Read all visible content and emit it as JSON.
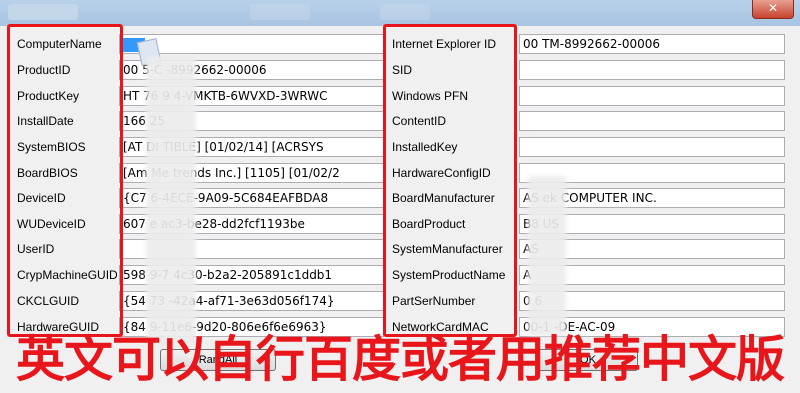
{
  "window": {
    "close_glyph": "✕"
  },
  "left_labels": [
    "ComputerName",
    "ProductID",
    "ProductKey",
    "InstallDate",
    "SystemBIOS",
    "BoardBIOS",
    "DeviceID",
    "WUDeviceID",
    "UserID",
    "CrypMachineGUID",
    "CKCLGUID",
    "HardwareGUID"
  ],
  "left_values": [
    "",
    "00         5-C    -8992662-00006",
    "HT       76    9     4-VMKTB-6WVXD-3WRWC",
    "166        25",
    "[AT       DI         TIBLE] [01/02/14] [ACRSYS",
    "[Am        Me     trends Inc.] [1105] [01/02/2",
    "{C7               6-4ECE-9A09-5C684EAFBDA8",
    "607        e        ac3-be28-dd2fcf1193be",
    "",
    "598        9-7        4c30-b2a2-205891c1ddb1",
    "{54          73        -42a4-af71-3e63d056f174}",
    "{84             9-11e6-9d20-806e6f6e6963}"
  ],
  "right_labels": [
    "Internet Explorer ID",
    "SID",
    "Windows PFN",
    "ContentID",
    "InstalledKey",
    "HardwareConfigID",
    "BoardManufacturer",
    "BoardProduct",
    "SystemManufacturer",
    "SystemProductName",
    "PartSerNumber",
    "NetworkCardMAC"
  ],
  "right_values": [
    "00        TM-8992662-00006",
    "",
    "",
    "",
    "",
    "",
    "AS        ek COMPUTER INC.",
    "B8        US",
    "AS",
    "A         ",
    "0         6",
    "00-1         -DE-AC-09"
  ],
  "buttons": {
    "random": "RandAll",
    "ok": "OK"
  },
  "caption": "英文可以自行百度或者用推荐中文版",
  "colors": {
    "highlight_red": "#e8151b",
    "title_bar": "#b9d1ea"
  }
}
